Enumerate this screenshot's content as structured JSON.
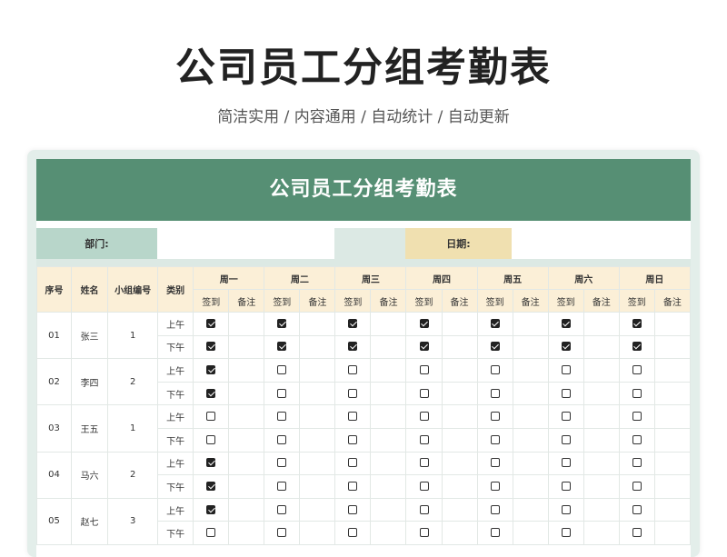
{
  "title": "公司员工分组考勤表",
  "subtitle": "简洁实用 / 内容通用 / 自动统计 / 自动更新",
  "sheet_title": "公司员工分组考勤表",
  "info": {
    "dept_label": "部门:",
    "dept_value": "",
    "date_label": "日期:",
    "date_value": ""
  },
  "headers": {
    "seq": "序号",
    "name": "姓名",
    "group": "小组编号",
    "type": "类别",
    "days": [
      "周一",
      "周二",
      "周三",
      "周四",
      "周五",
      "周六",
      "周日"
    ],
    "checkin": "签到",
    "note": "备注"
  },
  "rows": [
    {
      "seq": "01",
      "name": "张三",
      "group": "1",
      "periods": [
        {
          "label": "上午",
          "checks": [
            true,
            true,
            true,
            true,
            true,
            true,
            true
          ]
        },
        {
          "label": "下午",
          "checks": [
            true,
            true,
            true,
            true,
            true,
            true,
            true
          ]
        }
      ]
    },
    {
      "seq": "02",
      "name": "李四",
      "group": "2",
      "periods": [
        {
          "label": "上午",
          "checks": [
            true,
            false,
            false,
            false,
            false,
            false,
            false
          ]
        },
        {
          "label": "下午",
          "checks": [
            true,
            false,
            false,
            false,
            false,
            false,
            false
          ]
        }
      ]
    },
    {
      "seq": "03",
      "name": "王五",
      "group": "1",
      "periods": [
        {
          "label": "上午",
          "checks": [
            false,
            false,
            false,
            false,
            false,
            false,
            false
          ]
        },
        {
          "label": "下午",
          "checks": [
            false,
            false,
            false,
            false,
            false,
            false,
            false
          ]
        }
      ]
    },
    {
      "seq": "04",
      "name": "马六",
      "group": "2",
      "periods": [
        {
          "label": "上午",
          "checks": [
            true,
            false,
            false,
            false,
            false,
            false,
            false
          ]
        },
        {
          "label": "下午",
          "checks": [
            true,
            false,
            false,
            false,
            false,
            false,
            false
          ]
        }
      ]
    },
    {
      "seq": "05",
      "name": "赵七",
      "group": "3",
      "periods": [
        {
          "label": "上午",
          "checks": [
            true,
            false,
            false,
            false,
            false,
            false,
            false
          ]
        },
        {
          "label": "下午",
          "checks": [
            false,
            false,
            false,
            false,
            false,
            false,
            false
          ]
        }
      ]
    }
  ]
}
